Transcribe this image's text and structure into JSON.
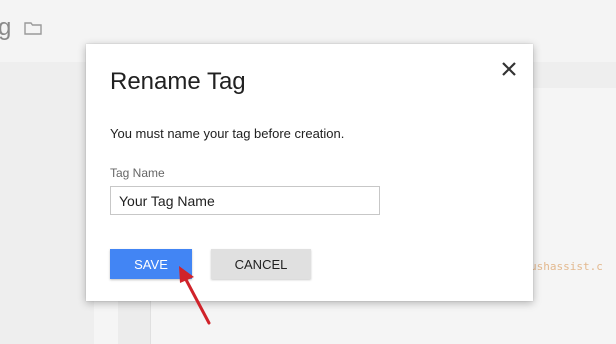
{
  "background": {
    "title_fragment": "g",
    "folder_icon": "folder-icon",
    "code_snippet": "ushassist.c"
  },
  "dialog": {
    "title": "Rename Tag",
    "close_icon": "close-icon",
    "description": "You must name your tag before creation.",
    "field_label": "Tag Name",
    "field_value": "Your Tag Name",
    "save_label": "SAVE",
    "cancel_label": "CANCEL"
  },
  "colors": {
    "primary": "#4285f4",
    "secondary_button": "#e0e0e0",
    "annotation": "#d0232a"
  },
  "annotation": {
    "icon": "arrow-icon",
    "points_to": "save-button"
  }
}
